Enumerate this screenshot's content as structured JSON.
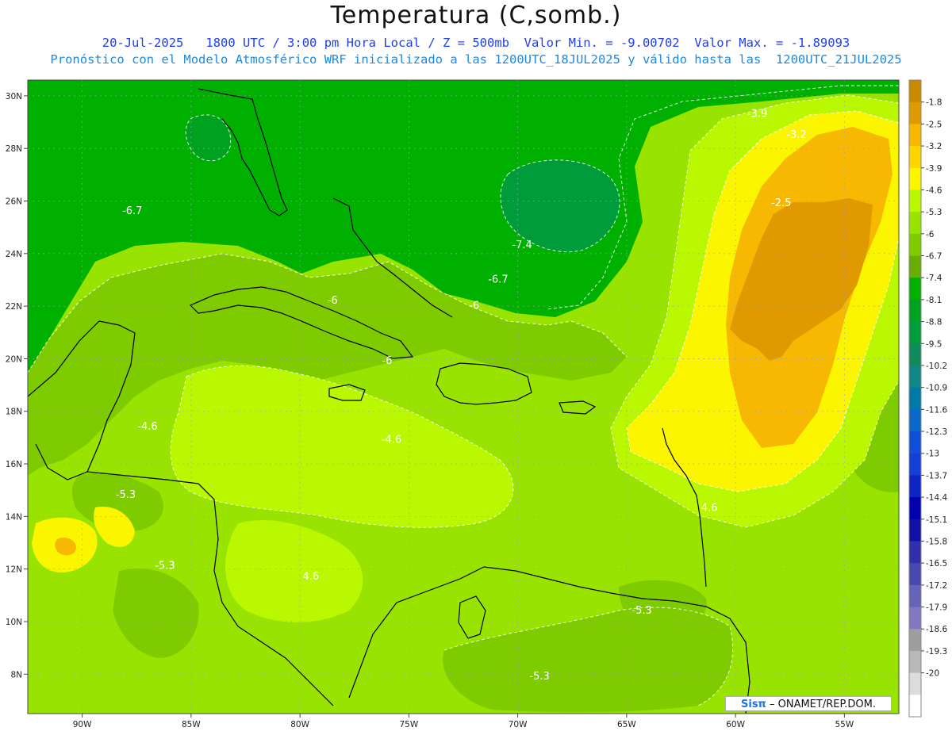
{
  "header": {
    "title": "Temperatura (C,somb.)",
    "line1": "20-Jul-2025   1800 UTC / 3:00 pm Hora Local / Z = 500mb  Valor Min. = -9.00702  Valor Max. = -1.89093",
    "line2": "Pronóstico con el Modelo Atmosférico WRF inicializado a las 1200UTC_18JUL2025 y válido hasta las  1200UTC_21JUL2025"
  },
  "map": {
    "lon_min": -92.5,
    "lon_max": -52.5,
    "lat_min": 6.5,
    "lat_max": 30.6,
    "lon_ticks": [
      {
        "value": -90,
        "label": "90W"
      },
      {
        "value": -85,
        "label": "85W"
      },
      {
        "value": -80,
        "label": "80W"
      },
      {
        "value": -75,
        "label": "75W"
      },
      {
        "value": -70,
        "label": "70W"
      },
      {
        "value": -65,
        "label": "65W"
      },
      {
        "value": -60,
        "label": "60W"
      },
      {
        "value": -55,
        "label": "55W"
      }
    ],
    "lat_ticks": [
      {
        "value": 8,
        "label": "8N"
      },
      {
        "value": 10,
        "label": "10N"
      },
      {
        "value": 12,
        "label": "12N"
      },
      {
        "value": 14,
        "label": "14N"
      },
      {
        "value": 16,
        "label": "16N"
      },
      {
        "value": 18,
        "label": "18N"
      },
      {
        "value": 20,
        "label": "20N"
      },
      {
        "value": 22,
        "label": "22N"
      },
      {
        "value": 24,
        "label": "24N"
      },
      {
        "value": 26,
        "label": "26N"
      },
      {
        "value": 28,
        "label": "28N"
      },
      {
        "value": 30,
        "label": "30N"
      }
    ],
    "contour_labels": [
      {
        "text": "-6.7",
        "lon": -87.7,
        "lat": 25.5
      },
      {
        "text": "-7.4",
        "lon": -69.8,
        "lat": 24.2
      },
      {
        "text": "-6.7",
        "lon": -70.9,
        "lat": 22.9
      },
      {
        "text": "-6",
        "lon": -78.5,
        "lat": 22.1
      },
      {
        "text": "-6",
        "lon": -72.0,
        "lat": 21.9
      },
      {
        "text": "-6",
        "lon": -76.0,
        "lat": 19.8
      },
      {
        "text": "-4.6",
        "lon": -87.0,
        "lat": 17.3
      },
      {
        "text": "-4.6",
        "lon": -75.8,
        "lat": 16.8
      },
      {
        "text": "-5.3",
        "lon": -88.0,
        "lat": 14.7
      },
      {
        "text": "-5.3",
        "lon": -86.2,
        "lat": 12.0
      },
      {
        "text": "4.6",
        "lon": -79.5,
        "lat": 11.6
      },
      {
        "text": "-5.3",
        "lon": -64.3,
        "lat": 10.3
      },
      {
        "text": "-5.3",
        "lon": -69.0,
        "lat": 7.8
      },
      {
        "text": "4.6",
        "lon": -61.2,
        "lat": 14.2
      },
      {
        "text": "-3.9",
        "lon": -59.0,
        "lat": 29.2
      },
      {
        "text": "-3.2",
        "lon": -57.2,
        "lat": 28.4
      },
      {
        "text": "-2.5",
        "lon": -57.9,
        "lat": 25.8
      }
    ]
  },
  "legend": {
    "levels": [
      "-1.8",
      "-2.5",
      "-3.2",
      "-3.9",
      "-4.6",
      "-5.3",
      "-6",
      "-6.7",
      "-7.4",
      "-8.1",
      "-8.8",
      "-9.5",
      "-10.2",
      "-10.9",
      "-11.6",
      "-12.3",
      "-13",
      "-13.7",
      "-14.4",
      "-15.1",
      "-15.8",
      "-16.5",
      "-17.2",
      "-17.9",
      "-18.6",
      "-19.3",
      "-20"
    ],
    "colors": [
      "#c98a00",
      "#e09a00",
      "#f6b800",
      "#ffd500",
      "#fbf500",
      "#b9f800",
      "#98e400",
      "#7ecb00",
      "#6aad00",
      "#00b000",
      "#00a020",
      "#009c3c",
      "#108a58",
      "#108888",
      "#0078a8",
      "#0a68c8",
      "#1050d8",
      "#1540d8",
      "#0e24c4",
      "#0000b0",
      "#1010a4",
      "#3030ac",
      "#4848b0",
      "#6464b8",
      "#8078c0",
      "#9e9e9e",
      "#b9b9b9",
      "#dcdcdc",
      "#ffffff"
    ]
  },
  "credit": {
    "sis": "Sisπ",
    "rest": " – ONAMET/REP.DOM."
  }
}
